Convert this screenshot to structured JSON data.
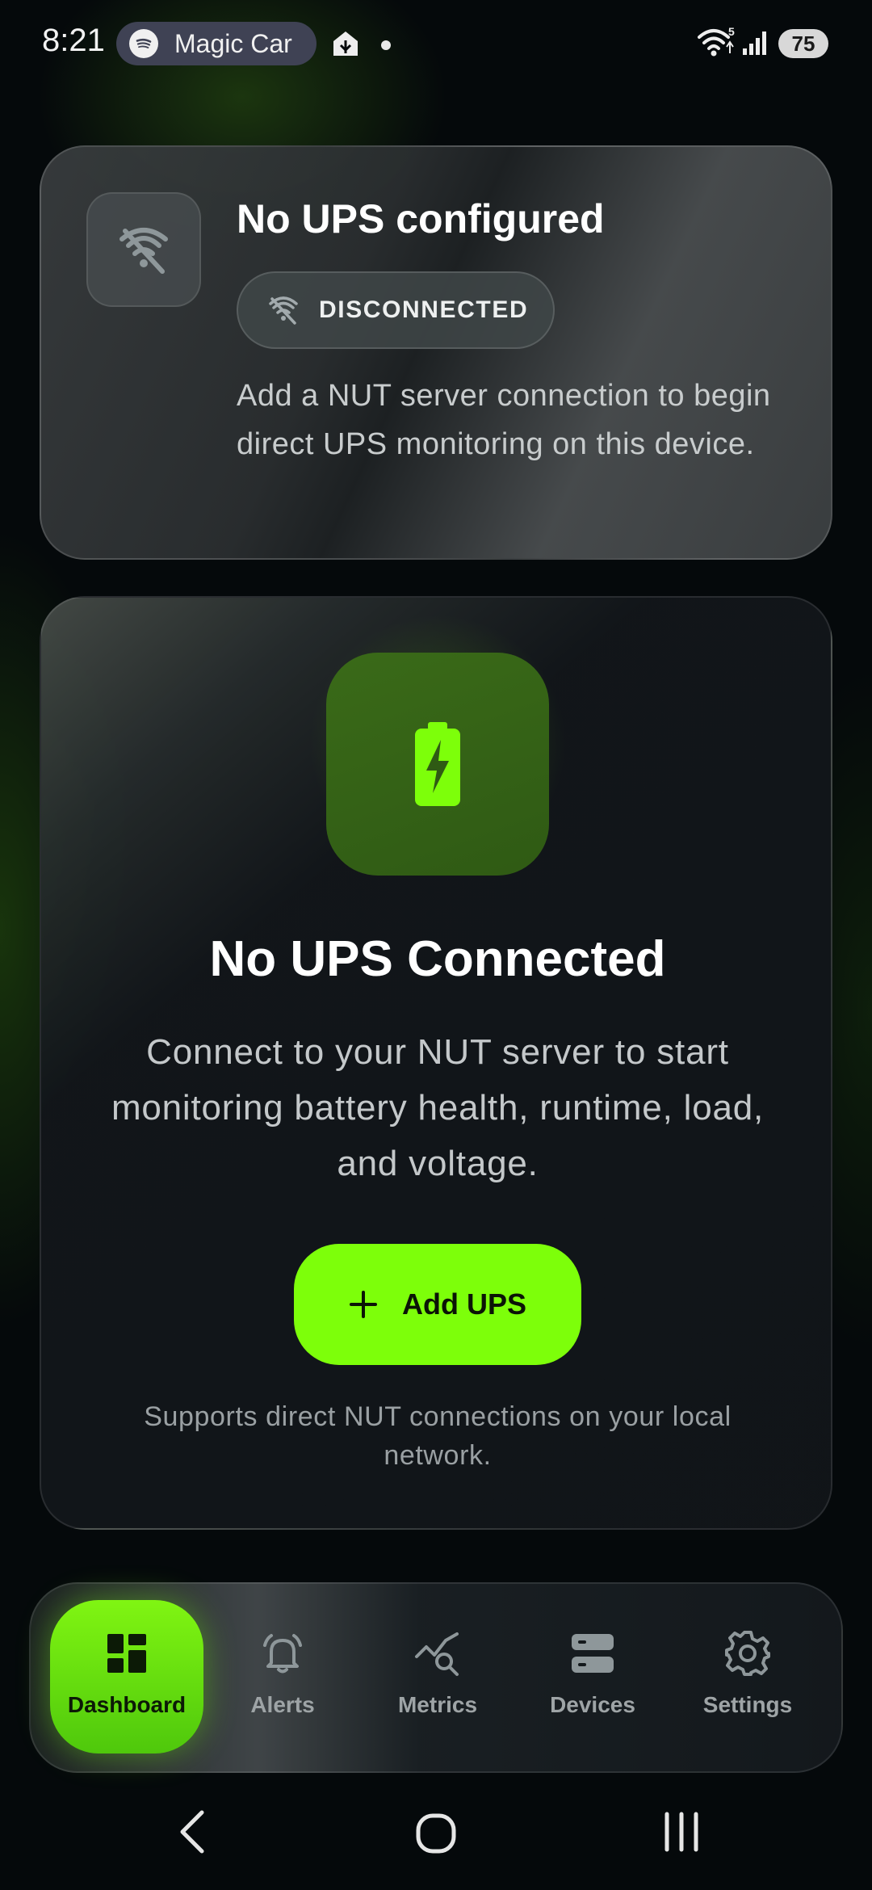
{
  "status_bar": {
    "time": "8:21",
    "media_title": "Magic Car",
    "battery_level": "75",
    "wifi_badge": "5",
    "icons": [
      "spotify-icon",
      "home-icon",
      "notification-dot",
      "wifi-icon",
      "signal-icon",
      "battery-icon"
    ]
  },
  "config_card": {
    "title": "No UPS configured",
    "status_label": "DISCONNECTED",
    "description": "Add a NUT server connection to begin direct UPS monitoring on this device.",
    "icon": "disconnected-icon"
  },
  "empty_state": {
    "title": "No UPS Connected",
    "description": "Connect to your NUT server to start monitoring battery health, runtime, load, and voltage.",
    "button_label": "Add UPS",
    "footnote": "Supports direct NUT connections on your local network.",
    "icon": "battery-charging-icon"
  },
  "bottom_nav": {
    "items": [
      {
        "label": "Dashboard",
        "icon": "dashboard-icon",
        "active": true
      },
      {
        "label": "Alerts",
        "icon": "bell-icon",
        "active": false
      },
      {
        "label": "Metrics",
        "icon": "chart-search-icon",
        "active": false
      },
      {
        "label": "Devices",
        "icon": "server-icon",
        "active": false
      },
      {
        "label": "Settings",
        "icon": "gear-icon",
        "active": false
      }
    ]
  },
  "colors": {
    "accent": "#7dff0a",
    "background": "#05090b",
    "card": "#111519",
    "muted_text": "#9ea4a6"
  }
}
